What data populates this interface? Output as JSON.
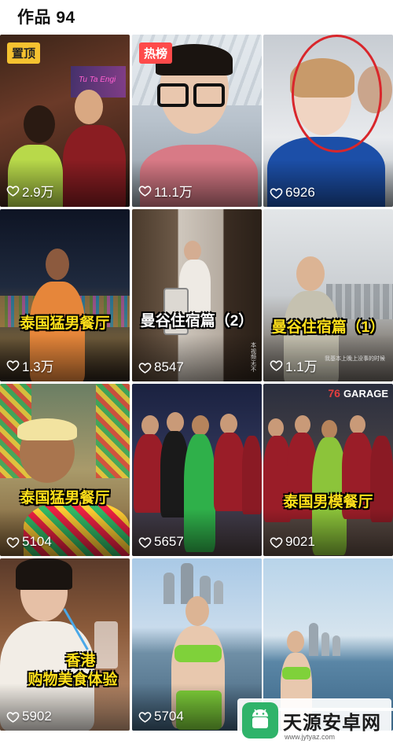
{
  "header": {
    "title": "作品 94"
  },
  "tiles": [
    {
      "likes": "2.9万",
      "badge": "置顶"
    },
    {
      "likes": "11.1万",
      "badge": "热榜"
    },
    {
      "likes": "6926"
    },
    {
      "likes": "1.3万",
      "caption": "泰国猛男餐厅"
    },
    {
      "likes": "8547",
      "caption": "曼谷住宿篇（2）",
      "side_text": "本视频无不"
    },
    {
      "likes": "1.1万",
      "caption": "曼谷住宿篇（1）",
      "subtitle": "我基本上晚上没事的时候"
    },
    {
      "likes": "5104",
      "caption": "泰国猛男餐厅"
    },
    {
      "likes": "5657"
    },
    {
      "likes": "9021",
      "caption": "泰国男模餐厅",
      "sign_number": "76",
      "sign_text": "GARAGE"
    },
    {
      "likes": "5902",
      "caption_line1": "香港",
      "caption_line2": "购物美食体验"
    },
    {
      "likes": "5704"
    },
    {
      "likes": ""
    }
  ],
  "neon_sign": "Tu Ta Engi",
  "watermark": {
    "name": "天源安卓网",
    "url": "www.jytyaz.com"
  },
  "colors": {
    "pin_badge": "#f5c230",
    "hot_badge": "#fe4a4a",
    "caption": "#ffe01a",
    "highlight_circle": "#d9262b"
  }
}
